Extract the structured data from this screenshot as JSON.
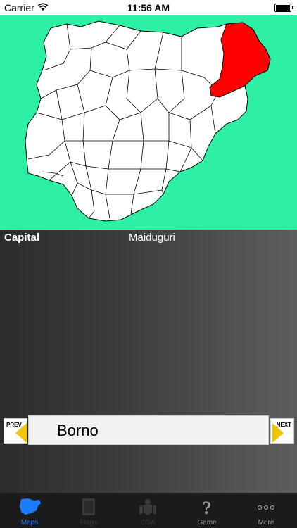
{
  "status_bar": {
    "carrier": "Carrier",
    "time": "11:56 AM",
    "wifi_icon": "wifi-icon",
    "battery_icon": "battery-icon"
  },
  "map": {
    "background_color": "#2ef0a4",
    "highlight_color": "#ff0000",
    "outline_color": "#000000"
  },
  "info": {
    "capital_label": "Capital",
    "capital_value": "Maiduguri"
  },
  "navigator": {
    "prev_label": "PREV",
    "next_label": "NEXT",
    "state_name": "Borno",
    "arrow_color": "#f5c400"
  },
  "tabs": [
    {
      "label": "Maps",
      "icon": "map-icon",
      "active": true,
      "color": "#1c7cff"
    },
    {
      "label": "Flags",
      "icon": "flag-book-icon",
      "active": false,
      "color": "#3a3a3a"
    },
    {
      "label": "COA",
      "icon": "coat-of-arms-icon",
      "active": false,
      "color": "#3a3a3a"
    },
    {
      "label": "Game",
      "icon": "question-mark-icon",
      "active": false,
      "color": "#9a9a9a"
    },
    {
      "label": "More",
      "icon": "more-dots-icon",
      "active": false,
      "color": "#9a9a9a"
    }
  ]
}
